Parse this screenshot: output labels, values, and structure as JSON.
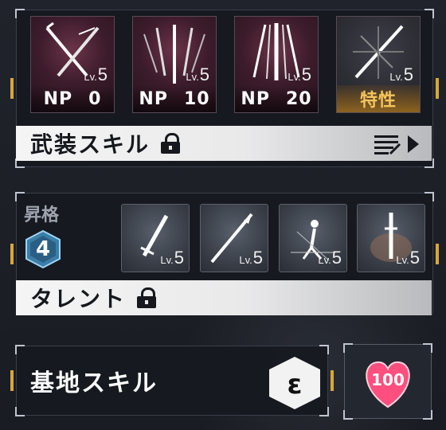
{
  "noble_phantasm": {
    "cards": [
      {
        "icon": "crossed-swords-icon",
        "lv_prefix": "Lv.",
        "lv_value": "5",
        "label_np": "NP",
        "label_value": "0"
      },
      {
        "icon": "sword-fan-icon",
        "lv_prefix": "Lv.",
        "lv_value": "5",
        "label_np": "NP",
        "label_value": "10"
      },
      {
        "icon": "claw-swords-icon",
        "lv_prefix": "Lv.",
        "lv_value": "5",
        "label_np": "NP",
        "label_value": "20"
      },
      {
        "icon": "sword-burst-icon",
        "lv_prefix": "Lv.",
        "lv_value": "5",
        "label_np": "",
        "label_value": "特性"
      }
    ],
    "bar_title": "武装スキル"
  },
  "ascension": {
    "label": "昇格",
    "rank": "4",
    "skills": [
      {
        "icon": "drill-sword-icon",
        "lv_prefix": "Lv.",
        "lv_value": "5"
      },
      {
        "icon": "lance-icon",
        "lv_prefix": "Lv.",
        "lv_value": "5"
      },
      {
        "icon": "figure-burst-icon",
        "lv_prefix": "Lv.",
        "lv_value": "5"
      },
      {
        "icon": "tower-flame-icon",
        "lv_prefix": "Lv.",
        "lv_value": "5"
      }
    ],
    "bar_title": "タレント"
  },
  "base": {
    "title": "基地スキル",
    "stage_icon": "e-hexagon-icon",
    "affection": "100"
  },
  "colors": {
    "accent": "#d9a737",
    "trait": "#f4c45c",
    "heart": "#ff4f7f"
  }
}
